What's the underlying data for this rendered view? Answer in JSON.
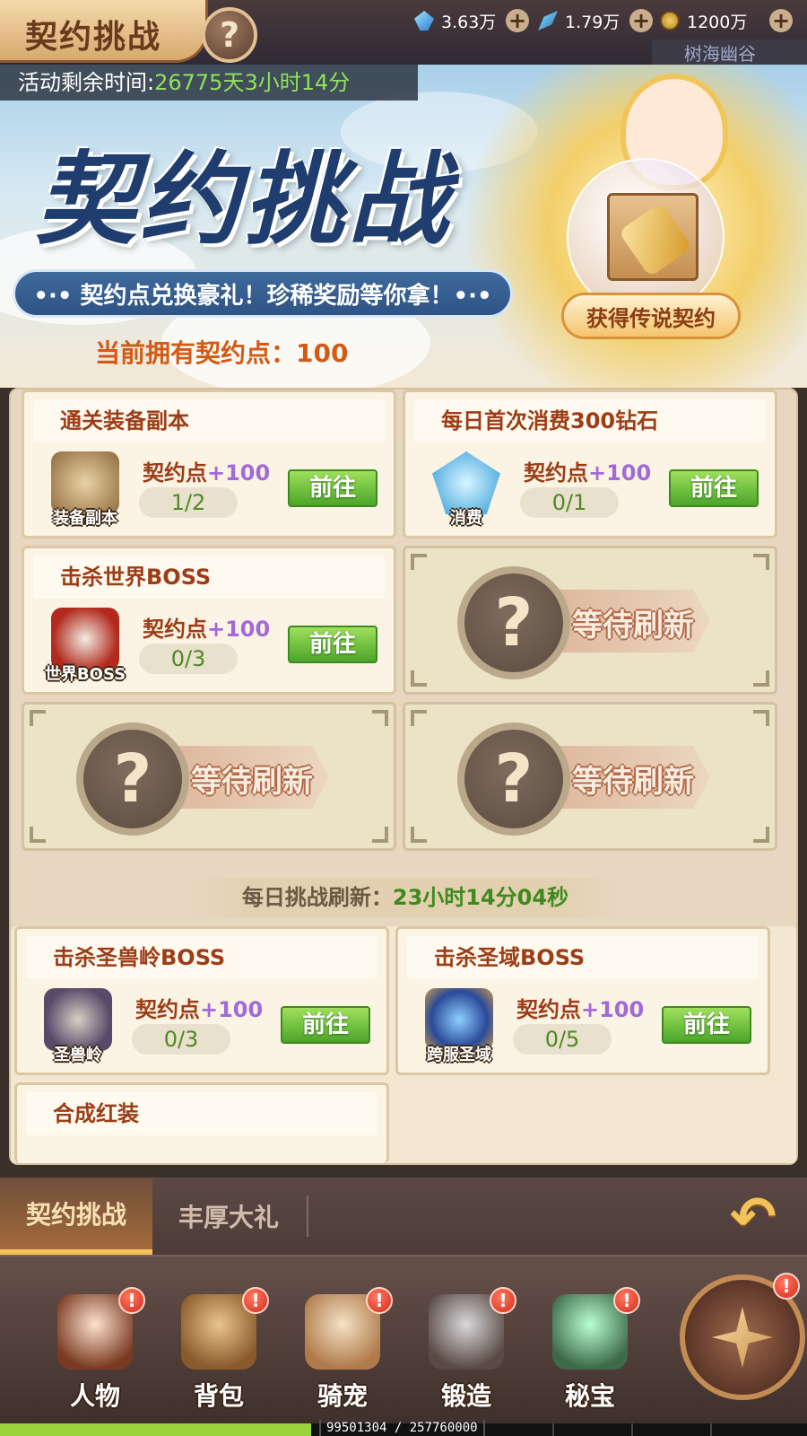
{
  "header": {
    "title": "契约挑战",
    "help_icon": "question-icon",
    "resources": [
      {
        "icon": "crystal-icon",
        "value": "3.63万"
      },
      {
        "icon": "feather-icon",
        "value": "1.79万"
      },
      {
        "icon": "coin-icon",
        "value": "1200万"
      }
    ],
    "area_name": "树海幽谷"
  },
  "banner": {
    "timer_label": "活动剩余时间:",
    "timer_value": "26775天3小时14分",
    "big_title": "契约挑战",
    "slogan": "•·• 契约点兑换豪礼！珍稀奖励等你拿！•·•",
    "reward_button": "获得传说契约",
    "points_text": "当前拥有契约点：100"
  },
  "tasks": [
    {
      "title": "通关装备副本",
      "icon_caption": "装备副本",
      "reward_label": "契约点",
      "reward_value": "+100",
      "progress": "1/2",
      "progress_fraction": 0.5,
      "button": "前往"
    },
    {
      "title": "每日首次消费300钻石",
      "icon_caption": "消费",
      "reward_label": "契约点",
      "reward_value": "+100",
      "progress": "0/1",
      "progress_fraction": 0,
      "button": "前往"
    },
    {
      "title": "击杀世界BOSS",
      "icon_caption": "世界BOSS",
      "reward_label": "契约点",
      "reward_value": "+100",
      "progress": "0/3",
      "progress_fraction": 0,
      "button": "前往"
    }
  ],
  "pending_label": "等待刷新",
  "refresh": {
    "label": "每日挑战刷新：",
    "value": "23小时14分04秒"
  },
  "weekly_tasks": [
    {
      "title": "击杀圣兽岭BOSS",
      "icon_caption": "圣兽岭",
      "reward_label": "契约点",
      "reward_value": "+100",
      "progress": "0/3",
      "button": "前往"
    },
    {
      "title": "击杀圣域BOSS",
      "icon_caption": "跨服圣域",
      "reward_label": "契约点",
      "reward_value": "+100",
      "progress": "0/5",
      "button": "前往"
    },
    {
      "title": "合成红装"
    }
  ],
  "tabs": [
    {
      "label": "契约挑战",
      "active": true
    },
    {
      "label": "丰厚大礼",
      "active": false
    }
  ],
  "nav": [
    {
      "label": "人物",
      "badge": "!"
    },
    {
      "label": "背包",
      "badge": "!"
    },
    {
      "label": "骑宠",
      "badge": "!"
    },
    {
      "label": "锻造",
      "badge": "!"
    },
    {
      "label": "秘宝",
      "badge": "!"
    }
  ],
  "compass_badge": "!",
  "exp": {
    "text": "99501304 / 257760000",
    "current": 99501304,
    "max": 257760000
  },
  "colors": {
    "accent_green": "#4ca52a",
    "reward_purple": "#a26ad8",
    "title_brown": "#9c3d16",
    "progress_green": "#4f8a23",
    "timer_green": "#8fe35a"
  }
}
